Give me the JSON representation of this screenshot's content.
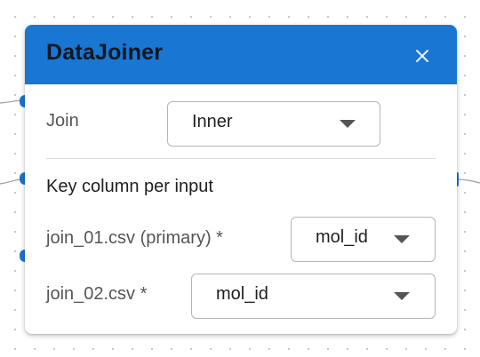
{
  "node": {
    "title": "DataJoiner",
    "close_icon": "close-icon"
  },
  "join": {
    "label": "Join",
    "selected": "Inner"
  },
  "key_section": {
    "heading": "Key column per input",
    "inputs": [
      {
        "label": "join_01.csv (primary) *",
        "selected": "mol_id"
      },
      {
        "label": "join_02.csv *",
        "selected": "mol_id"
      }
    ]
  },
  "colors": {
    "header": "#1976d2",
    "port": "#1976d2",
    "title_text": "#101820"
  },
  "icons": [
    "close-icon",
    "chevron-down-icon"
  ]
}
